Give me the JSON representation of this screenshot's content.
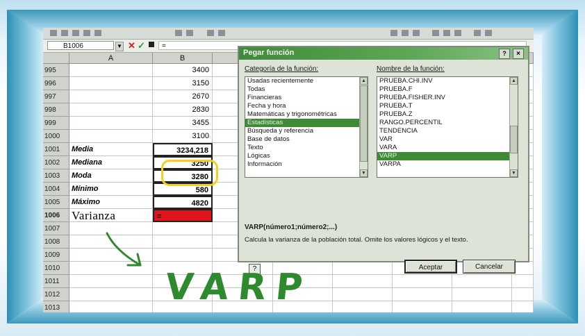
{
  "sheet": {
    "name_box": "B1006",
    "formula_value": "=",
    "columns": [
      "A",
      "B"
    ],
    "rows": [
      {
        "num": "995",
        "a": "",
        "b": "3400"
      },
      {
        "num": "996",
        "a": "",
        "b": "3150"
      },
      {
        "num": "997",
        "a": "",
        "b": "2670"
      },
      {
        "num": "998",
        "a": "",
        "b": "2830"
      },
      {
        "num": "999",
        "a": "",
        "b": "3455"
      },
      {
        "num": "1000",
        "a": "",
        "b": "3100"
      },
      {
        "num": "1001",
        "a": "Media",
        "b": "3234,218"
      },
      {
        "num": "1002",
        "a": "Mediana",
        "b": "3250"
      },
      {
        "num": "1003",
        "a": "Moda",
        "b": "3280"
      },
      {
        "num": "1004",
        "a": "Mínimo",
        "b": "580"
      },
      {
        "num": "1005",
        "a": "Máximo",
        "b": "4820"
      },
      {
        "num": "1006",
        "a": "Varianza",
        "b": "="
      },
      {
        "num": "1007",
        "a": "",
        "b": ""
      },
      {
        "num": "1008",
        "a": "",
        "b": ""
      },
      {
        "num": "1009",
        "a": "",
        "b": ""
      },
      {
        "num": "1010",
        "a": "",
        "b": ""
      },
      {
        "num": "1011",
        "a": "",
        "b": ""
      },
      {
        "num": "1012",
        "a": "",
        "b": ""
      },
      {
        "num": "1013",
        "a": "",
        "b": ""
      }
    ],
    "highlight_color": "#e0151b"
  },
  "dialog": {
    "title": "Pegar función",
    "help_label": "?",
    "close_label": "×",
    "category_label": "Categoría de la función:",
    "categories": [
      "Usadas recientemente",
      "Todas",
      "Financieras",
      "Fecha y hora",
      "Matemáticas y trigonométricas",
      "Estadísticas",
      "Búsqueda y referencia",
      "Base de datos",
      "Texto",
      "Lógicas",
      "Información"
    ],
    "selected_category": 5,
    "function_label": "Nombre de la función:",
    "functions": [
      "PRUEBA.CHI.INV",
      "PRUEBA.F",
      "PRUEBA.FISHER.INV",
      "PRUEBA.T",
      "PRUEBA.Z",
      "RANGO.PERCENTIL",
      "TENDENCIA",
      "VAR",
      "VARA",
      "VARP",
      "VARPA"
    ],
    "selected_function": 9,
    "syntax": "VARP(número1;número2;...)",
    "description": "Calcula la varianza de la población total. Omite los valores lógicos y el texto.",
    "ok_label": "Aceptar",
    "cancel_label": "Cancelar",
    "highlight_color": "#f2d01d"
  },
  "annotation": {
    "text": "VARP",
    "color": "#2f8a2e"
  },
  "icons": [
    "cancel-icon",
    "enter-icon",
    "function-icon",
    "formula-help-icon",
    "arrow-icon"
  ]
}
